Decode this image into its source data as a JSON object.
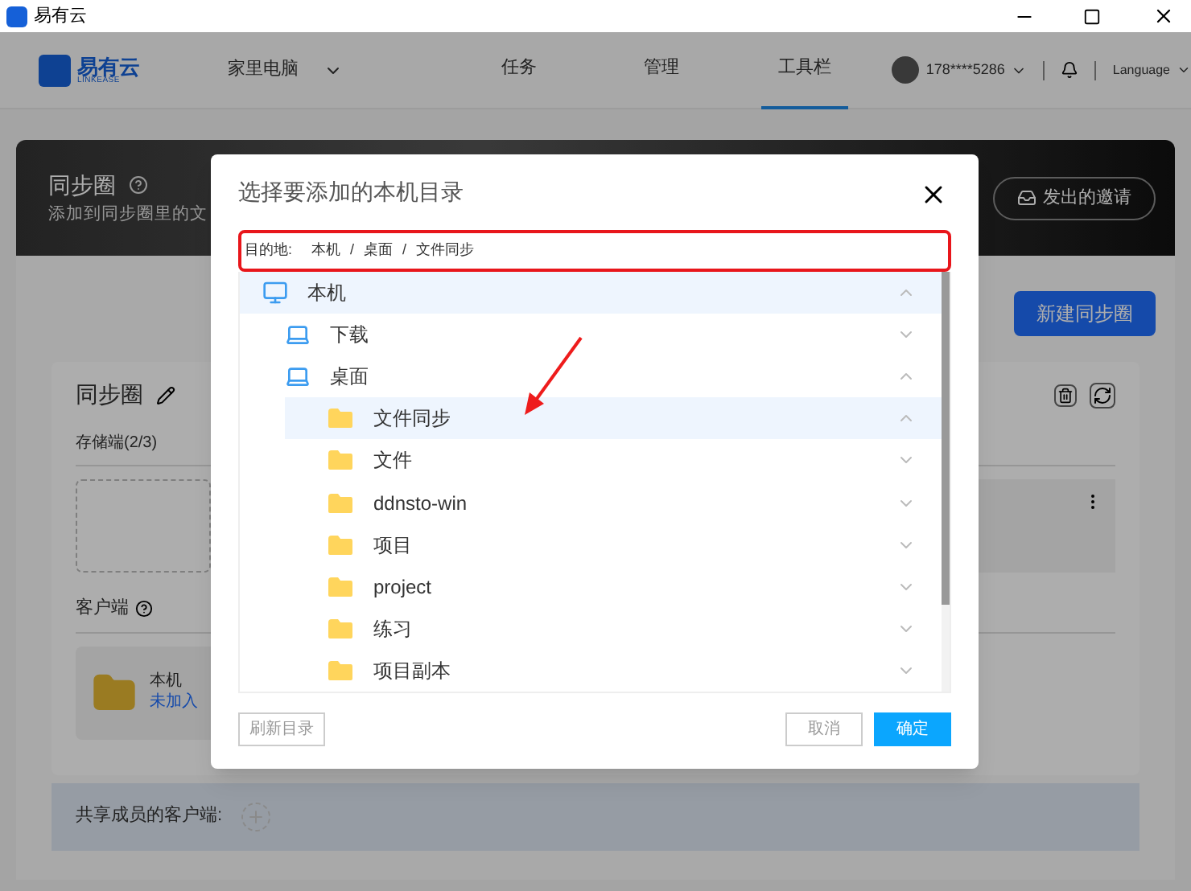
{
  "app_title": "易有云",
  "nav": {
    "logo_text": "易有云",
    "logo_subtext": "LINKEASE",
    "device": "家里电脑",
    "tabs": [
      {
        "label": "任务",
        "selected": false
      },
      {
        "label": "管理",
        "selected": false
      },
      {
        "label": "工具栏",
        "selected": true
      }
    ],
    "account": "178****5286",
    "language": "Language"
  },
  "banner": {
    "title": "同步圈",
    "subtitle": "添加到同步圈里的文",
    "invite_button": "发出的邀请"
  },
  "new_button": "新建同步圈",
  "card": {
    "title": "同步圈",
    "storage_label": "存储端(2/3)",
    "client_label": "客户端",
    "client": {
      "name": "本机",
      "status": "未加入"
    }
  },
  "shared_label": "共享成员的客户端:",
  "dialog": {
    "title": "选择要添加的本机目录",
    "destination": {
      "label": "目的地:",
      "separator": "/",
      "path": [
        "本机",
        "桌面",
        "文件同步"
      ]
    },
    "tree": [
      {
        "label": "本机",
        "kind": "computer",
        "expanded": true,
        "selected": true,
        "children": [
          {
            "label": "下载",
            "kind": "drive",
            "expanded": false,
            "selected": false
          },
          {
            "label": "桌面",
            "kind": "drive",
            "expanded": true,
            "selected": false,
            "children": [
              {
                "label": "文件同步",
                "kind": "folder",
                "expanded": true,
                "selected": true
              },
              {
                "label": "文件",
                "kind": "folder",
                "expanded": false,
                "selected": false
              },
              {
                "label": "ddnsto-win",
                "kind": "folder",
                "expanded": false,
                "selected": false
              },
              {
                "label": "项目",
                "kind": "folder",
                "expanded": false,
                "selected": false
              },
              {
                "label": "project",
                "kind": "folder",
                "expanded": false,
                "selected": false
              },
              {
                "label": "练习",
                "kind": "folder",
                "expanded": false,
                "selected": false
              },
              {
                "label": "项目副本",
                "kind": "folder",
                "expanded": false,
                "selected": false
              }
            ]
          }
        ]
      }
    ],
    "refresh_button": "刷新目录",
    "cancel_button": "取消",
    "ok_button": "确定"
  }
}
